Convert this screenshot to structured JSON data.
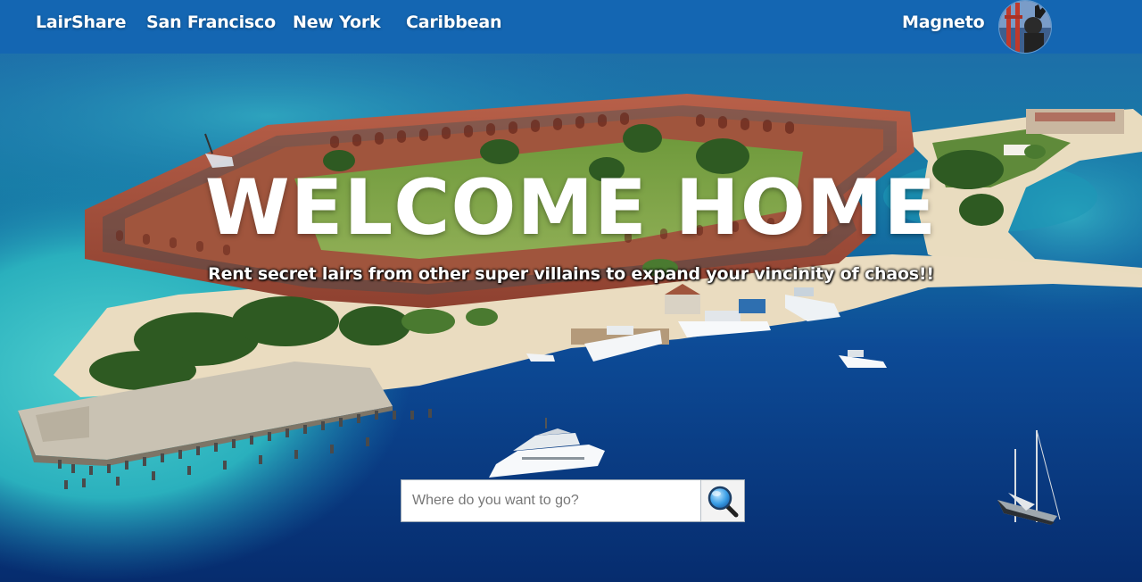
{
  "nav": {
    "brand": "LairShare",
    "links": [
      "San Francisco",
      "New York",
      "Caribbean"
    ],
    "user": "Magneto"
  },
  "hero": {
    "headline": "WELCOME HOME",
    "tagline": "Rent secret lairs from other super villains to expand your vincinity of chaos!!"
  },
  "search": {
    "placeholder": "Where do you want to go?",
    "button_icon": "search-icon"
  },
  "colors": {
    "nav_bg": "#1466b2",
    "sea_deep": "#0a3a8a",
    "sea_shallow": "#2bb3c0",
    "brick": "#a5503a",
    "sand": "#eadcc0"
  }
}
